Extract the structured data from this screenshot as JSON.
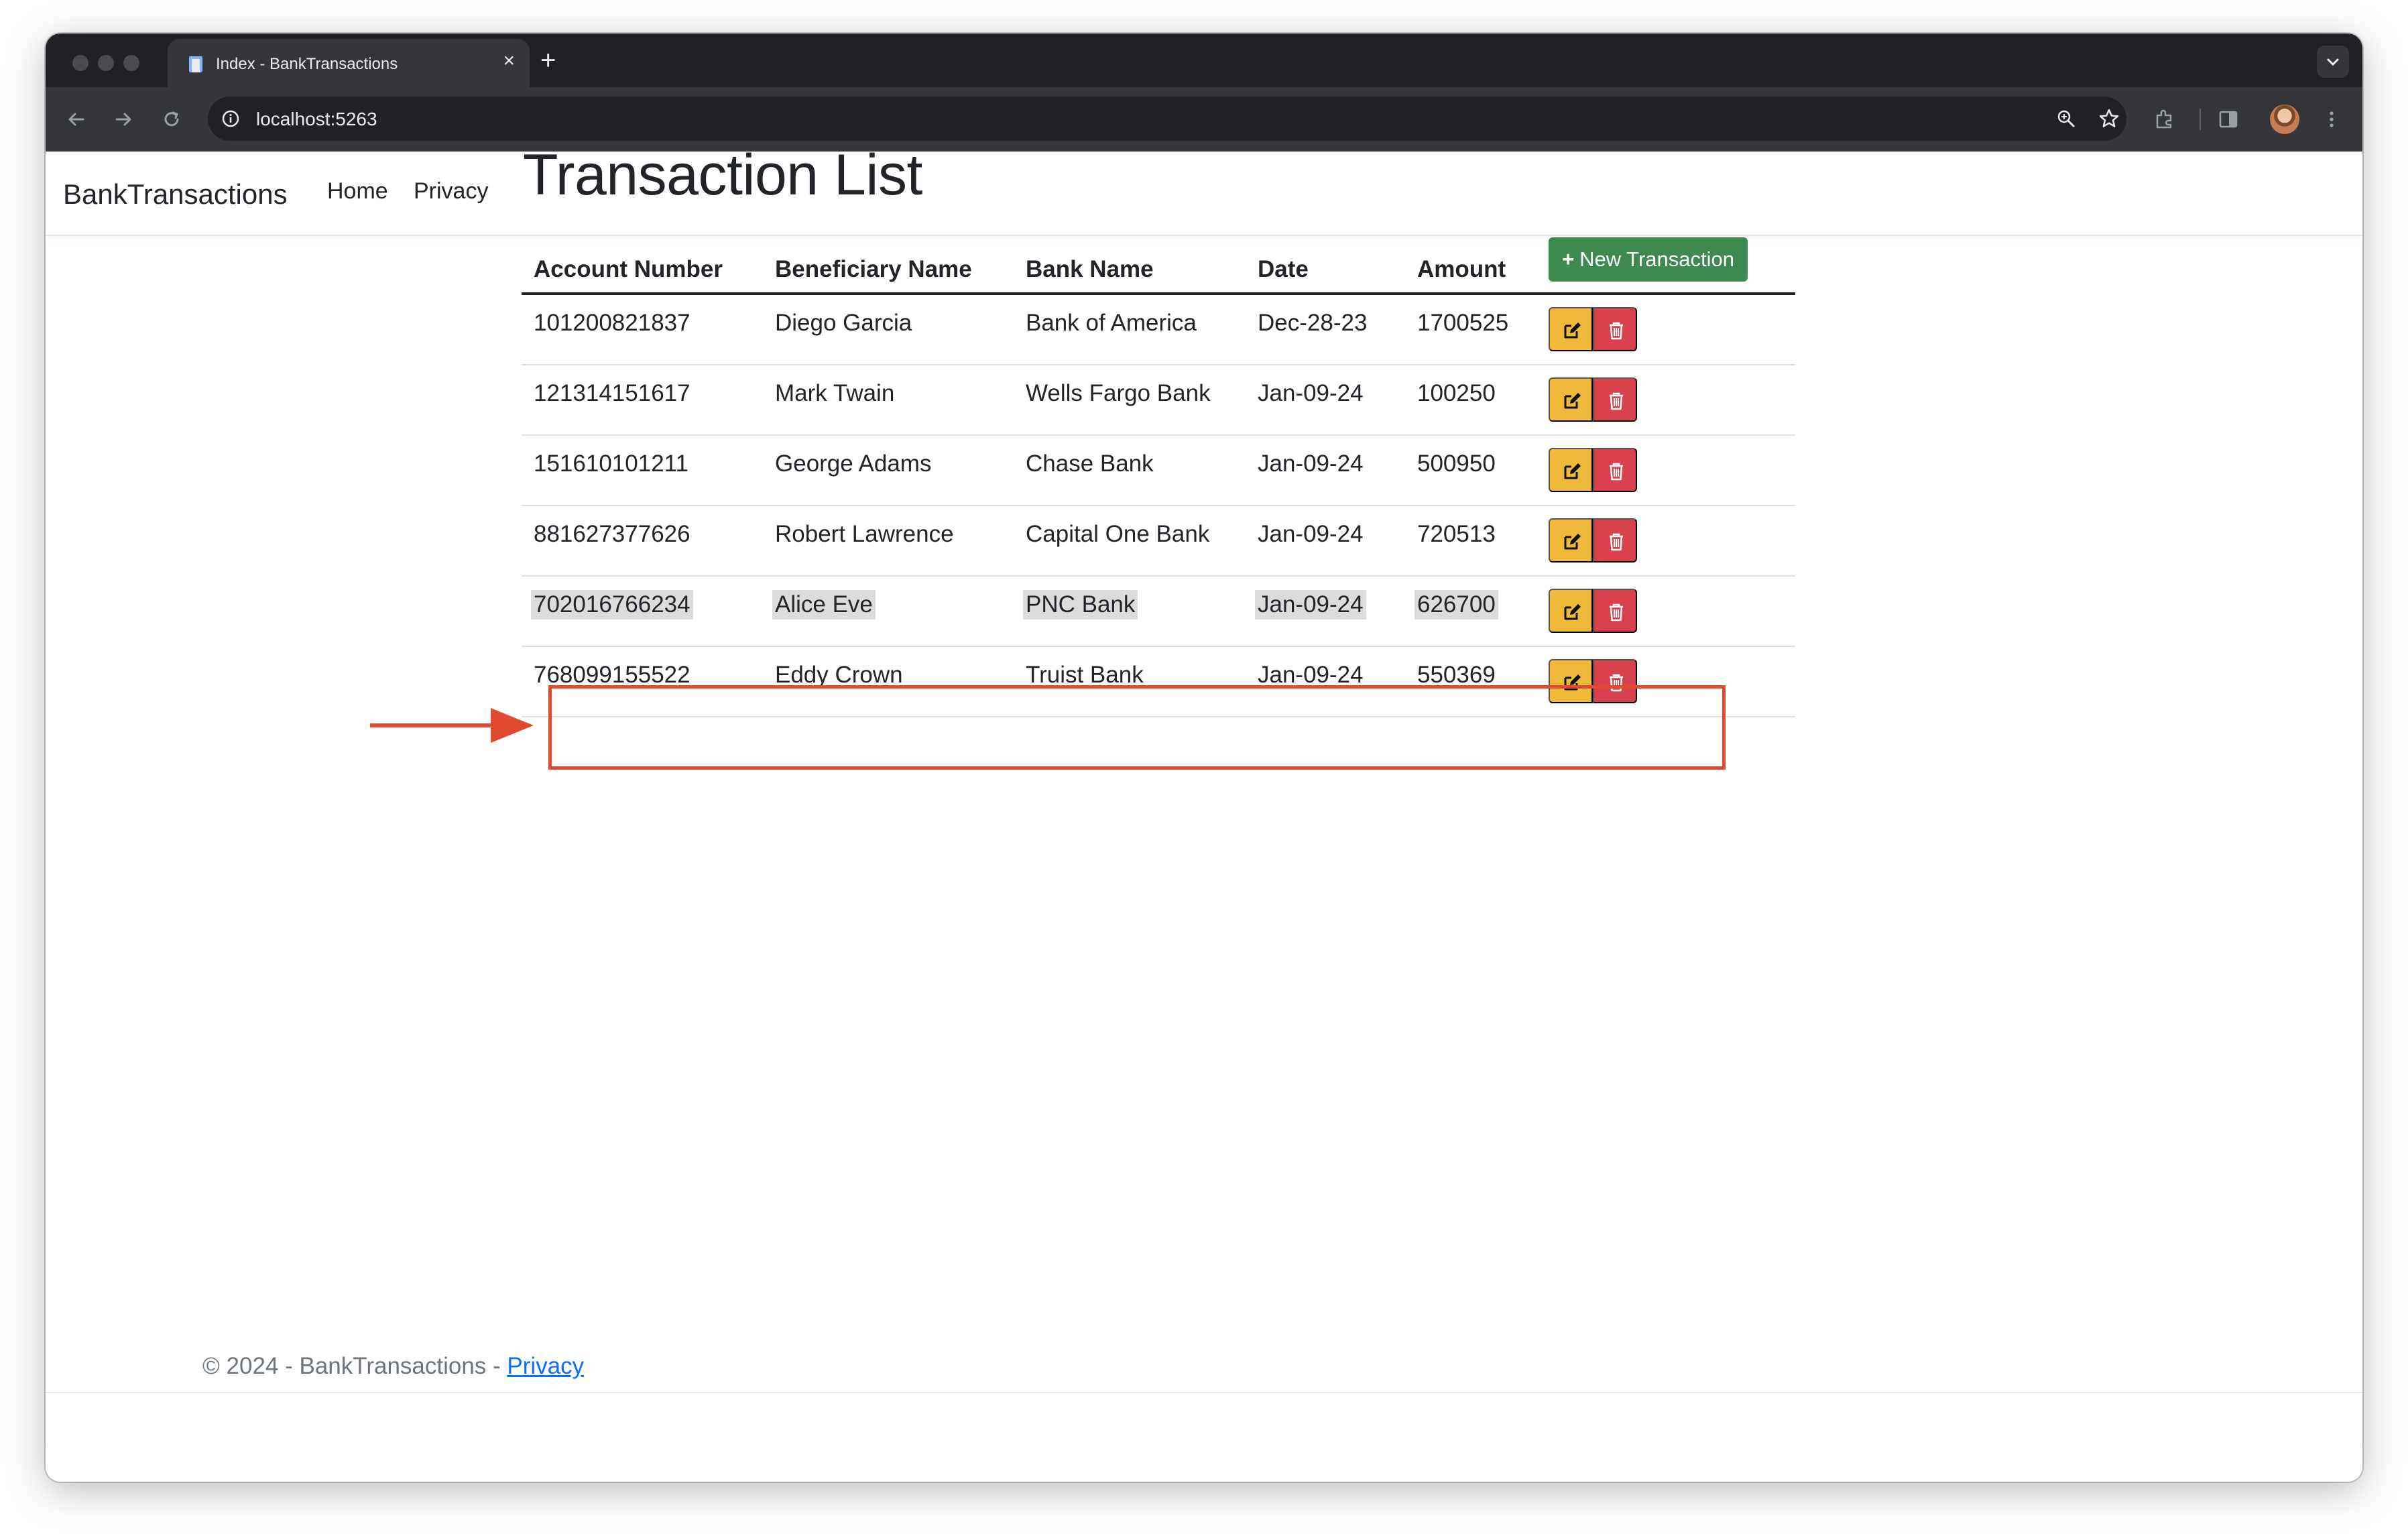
{
  "browser": {
    "tab_title": "Index - BankTransactions",
    "tab_close": "×",
    "new_tab": "+",
    "url": "localhost:5263"
  },
  "navbar": {
    "brand": "BankTransactions",
    "links": [
      "Home",
      "Privacy"
    ]
  },
  "page": {
    "title": "Transaction List"
  },
  "table": {
    "headers": [
      "Account Number",
      "Beneficiary Name",
      "Bank Name",
      "Date",
      "Amount"
    ],
    "new_button_label": "New Transaction",
    "new_button_icon": "+",
    "rows": [
      [
        "101200821837",
        "Diego Garcia",
        "Bank of America",
        "Dec-28-23",
        "1700525"
      ],
      [
        "121314151617",
        "Mark Twain",
        "Wells Fargo Bank",
        "Jan-09-24",
        "100250"
      ],
      [
        "151610101211",
        "George Adams",
        "Chase Bank",
        "Jan-09-24",
        "500950"
      ],
      [
        "881627377626",
        "Robert Lawrence",
        "Capital One Bank",
        "Jan-09-24",
        "720513"
      ],
      [
        "702016766234",
        "Alice Eve",
        "PNC Bank",
        "Jan-09-24",
        "626700"
      ],
      [
        "768099155522",
        "Eddy Crown",
        "Truist Bank",
        "Jan-09-24",
        "550369"
      ]
    ],
    "selected_row": 4
  },
  "footer": {
    "text": "© 2024 - BankTransactions - ",
    "link": "Privacy"
  },
  "colors": {
    "new_button": "#3c8a4f",
    "edit_button": "#f0b93a",
    "delete_button": "#d9414c",
    "annotation": "#e04a2f"
  },
  "icons": {
    "edit": "edit-icon",
    "delete": "trash-icon"
  }
}
